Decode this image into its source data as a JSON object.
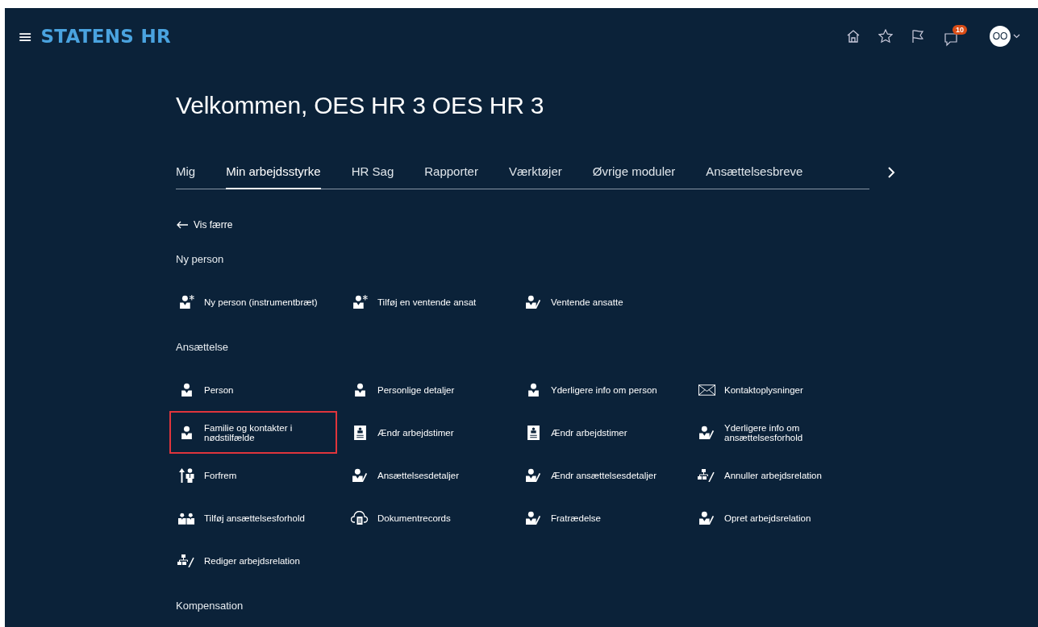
{
  "header": {
    "menu_glyph": "≡",
    "brand": "STATENS HR",
    "notification_count": "10",
    "avatar_initials": "OO"
  },
  "welcome": "Velkommen, OES HR 3 OES HR 3",
  "tabs": [
    {
      "label": "Mig",
      "selected": false
    },
    {
      "label": "Min arbejdsstyrke",
      "selected": true
    },
    {
      "label": "HR Sag",
      "selected": false
    },
    {
      "label": "Rapporter",
      "selected": false
    },
    {
      "label": "Værktøjer",
      "selected": false
    },
    {
      "label": "Øvrige moduler",
      "selected": false
    },
    {
      "label": "Ansættelsesbreve",
      "selected": false
    }
  ],
  "back_link": "Vis færre",
  "sections": [
    {
      "title": "Ny person",
      "items": [
        {
          "label": "Ny person (instrumentbræt)",
          "kind": "person-add",
          "highlighted": false
        },
        {
          "label": "Tilføj en ventende ansat",
          "kind": "person-add",
          "highlighted": false
        },
        {
          "label": "Ventende ansatte",
          "kind": "person-edit",
          "highlighted": false
        }
      ]
    },
    {
      "title": "Ansættelse",
      "items": [
        {
          "label": "Person",
          "kind": "person",
          "highlighted": false
        },
        {
          "label": "Personlige detaljer",
          "kind": "person",
          "highlighted": false
        },
        {
          "label": "Yderligere info om person",
          "kind": "person",
          "highlighted": false
        },
        {
          "label": "Kontaktoplysninger",
          "kind": "envelope",
          "highlighted": false
        },
        {
          "label": "Familie og kontakter i nødstilfælde",
          "kind": "person",
          "highlighted": true
        },
        {
          "label": "Ændr arbejdstimer",
          "kind": "badge",
          "highlighted": false
        },
        {
          "label": "Ændr arbejdstimer",
          "kind": "badge",
          "highlighted": false
        },
        {
          "label": "Yderligere info om ansættelsesforhold",
          "kind": "person-edit",
          "highlighted": false
        },
        {
          "label": "Forfrem",
          "kind": "promote",
          "highlighted": false
        },
        {
          "label": "Ansættelsesdetaljer",
          "kind": "person-edit",
          "highlighted": false
        },
        {
          "label": "Ændr ansættelsesdetaljer",
          "kind": "person-edit",
          "highlighted": false
        },
        {
          "label": "Annuller arbejdsrelation",
          "kind": "org-edit",
          "highlighted": false
        },
        {
          "label": "Tilføj ansættelsesforhold",
          "kind": "people",
          "highlighted": false
        },
        {
          "label": "Dokumentrecords",
          "kind": "cloud-doc",
          "highlighted": false
        },
        {
          "label": "Fratrædelse",
          "kind": "person-edit",
          "highlighted": false
        },
        {
          "label": "Opret arbejdsrelation",
          "kind": "person-edit",
          "highlighted": false
        },
        {
          "label": "Rediger arbejdsrelation",
          "kind": "org-edit",
          "highlighted": false
        }
      ]
    },
    {
      "title": "Kompensation"
    }
  ]
}
